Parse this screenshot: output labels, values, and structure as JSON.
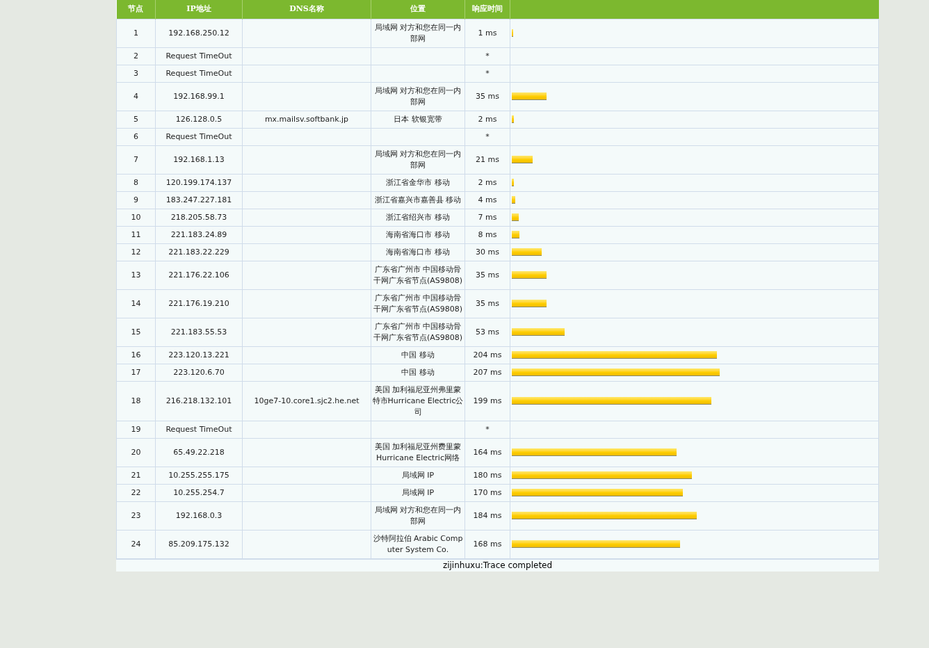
{
  "table": {
    "columns": [
      "节点",
      "IP地址",
      "DNS名称",
      "位置",
      "响应时间"
    ],
    "rows": [
      {
        "hop": "1",
        "ip": "192.168.250.12",
        "location": "局域网 对方和您在同一内部网",
        "time": "1 ms",
        "level": 0.004
      },
      {
        "hop": "2",
        "ip": "Request TimeOut",
        "time": "*"
      },
      {
        "hop": "3",
        "ip": "Request TimeOut",
        "time": "*"
      },
      {
        "hop": "4",
        "ip": "192.168.99.1",
        "location": "局域网 对方和您在同一内部网",
        "time": "35 ms",
        "level": 0.095
      },
      {
        "hop": "5",
        "ip": "126.128.0.5",
        "dns": "mx.mailsv.softbank.jp",
        "location": "日本 软银宽带",
        "time": "2 ms",
        "level": 0.006
      },
      {
        "hop": "6",
        "ip": "Request TimeOut",
        "time": "*"
      },
      {
        "hop": "7",
        "ip": "192.168.1.13",
        "location": "局域网 对方和您在同一内部网",
        "time": "21 ms",
        "level": 0.057
      },
      {
        "hop": "8",
        "ip": "120.199.174.137",
        "location": "浙江省金华市 移动",
        "time": "2 ms",
        "level": 0.006
      },
      {
        "hop": "9",
        "ip": "183.247.227.181",
        "location": "浙江省嘉兴市嘉善县 移动",
        "time": "4 ms",
        "level": 0.009
      },
      {
        "hop": "10",
        "ip": "218.205.58.73",
        "location": "浙江省绍兴市 移动",
        "time": "7 ms",
        "level": 0.019
      },
      {
        "hop": "11",
        "ip": "221.183.24.89",
        "location": "海南省海口市 移动",
        "time": "8 ms",
        "level": 0.021
      },
      {
        "hop": "12",
        "ip": "221.183.22.229",
        "location": "海南省海口市 移动",
        "time": "30 ms",
        "level": 0.082
      },
      {
        "hop": "13",
        "ip": "221.176.22.106",
        "location": "广东省广州市 中国移动骨干网广东省节点(AS9808)",
        "time": "35 ms",
        "level": 0.095
      },
      {
        "hop": "14",
        "ip": "221.176.19.210",
        "location": "广东省广州市 中国移动骨干网广东省节点(AS9808)",
        "time": "35 ms",
        "level": 0.095
      },
      {
        "hop": "15",
        "ip": "221.183.55.53",
        "location": "广东省广州市 中国移动骨干网广东省节点(AS9808)",
        "time": "53 ms",
        "level": 0.144
      },
      {
        "hop": "16",
        "ip": "223.120.13.221",
        "location": "中国 移动",
        "time": "204 ms",
        "level": 0.56
      },
      {
        "hop": "17",
        "ip": "223.120.6.70",
        "location": "中国 移动",
        "time": "207 ms",
        "level": 0.569
      },
      {
        "hop": "18",
        "ip": "216.218.132.101",
        "dns": "10ge7-10.core1.sjc2.he.net",
        "location": "美国 加利福尼亚州弗里蒙特市Hurricane Electric公司",
        "time": "199 ms",
        "level": 0.546
      },
      {
        "hop": "19",
        "ip": "Request TimeOut",
        "time": "*"
      },
      {
        "hop": "20",
        "ip": "65.49.22.218",
        "location": "美国 加利福尼亚州费里蒙Hurricane Electric网络",
        "time": "164 ms",
        "level": 0.45
      },
      {
        "hop": "21",
        "ip": "10.255.255.175",
        "location": "局域网 IP",
        "time": "180 ms",
        "level": 0.493
      },
      {
        "hop": "22",
        "ip": "10.255.254.7",
        "location": "局域网 IP",
        "time": "170 ms",
        "level": 0.467
      },
      {
        "hop": "23",
        "ip": "192.168.0.3",
        "location": "局域网 对方和您在同一内部网",
        "time": "184 ms",
        "level": 0.505
      },
      {
        "hop": "24",
        "ip": "85.209.175.132",
        "location": "沙特阿拉伯 Arabic Computer System Co.",
        "time": "168 ms",
        "level": 0.461
      }
    ]
  },
  "footer": "zijinhuxu:Trace completed"
}
